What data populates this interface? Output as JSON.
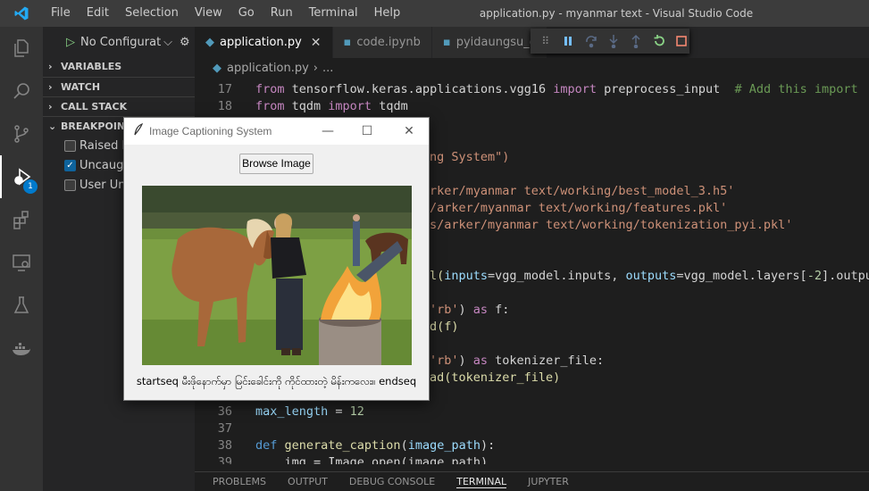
{
  "menubar": {
    "items": [
      "File",
      "Edit",
      "Selection",
      "View",
      "Go",
      "Run",
      "Terminal",
      "Help"
    ],
    "window_title": "application.py - myanmar text - Visual Studio Code"
  },
  "activitybar": {
    "icons": [
      "explorer-icon",
      "search-icon",
      "source-control-icon",
      "run-debug-icon",
      "extensions-icon",
      "remote-explorer-icon",
      "testing-icon",
      "docker-icon"
    ],
    "debug_badge": "1"
  },
  "sidebar": {
    "run_config": "No Configurat",
    "sections": {
      "variables": "VARIABLES",
      "watch": "WATCH",
      "call_stack": "CALL STACK",
      "breakpoints": "BREAKPOINTS"
    },
    "breakpoints": [
      {
        "label": "Raised Exceptions",
        "checked": false
      },
      {
        "label": "Uncaught Exceptions",
        "checked": true
      },
      {
        "label": "User Uncaught Exceptions",
        "checked": false
      }
    ]
  },
  "tabs": [
    {
      "label": "application.py",
      "active": true
    },
    {
      "label": "code.ipynb",
      "active": false
    },
    {
      "label": "pyidaungsu_c",
      "active": false
    }
  ],
  "breadcrumb": {
    "file": "application.py",
    "rest": "..."
  },
  "code": {
    "l17": {
      "num": "17",
      "t1": "from",
      "t2": " tensorflow.keras.applications.vgg16 ",
      "t3": "import",
      "t4": " preprocess_input  ",
      "t5": "# Add this import"
    },
    "l18": {
      "num": "18",
      "t1": "from",
      "t2": " tqdm ",
      "t3": "import",
      "t4": " tqdm"
    },
    "l_title": {
      "t1": "ng System\")"
    },
    "l_model": {
      "t1": "rker/myanmar text/working/best_model_3.h5'"
    },
    "l_feat": {
      "t1": "/arker/myanmar text/working/features.pkl'"
    },
    "l_tok": {
      "t1": "s/arker/myanmar text/working/tokenization_pyi.pkl'"
    },
    "l_vgg": {
      "t1": "l(",
      "t2": "inputs",
      "t3": "=vgg_model.inputs, ",
      "t4": "outputs",
      "t5": "=vgg_model.layers[",
      "t6": "-2",
      "t7": "].output)"
    },
    "l_rb1": {
      "t1": "'rb'",
      "t2": ") ",
      "t3": "as",
      "t4": " f:"
    },
    "l_load1": {
      "t1": "d(f)"
    },
    "l_rb2": {
      "t1": "'rb'",
      "t2": ") ",
      "t3": "as",
      "t4": " tokenizer_file:"
    },
    "l_load2": {
      "t1": "ad(tokenizer_file)"
    },
    "l36": {
      "num": "36",
      "t1": "max_length",
      "t2": " = ",
      "t3": "12"
    },
    "l37": {
      "num": "37"
    },
    "l38": {
      "num": "38",
      "t1": "def",
      "t2": " generate_caption",
      "t3": "(",
      "t4": "image_path",
      "t5": "):"
    },
    "l39": {
      "num": "39",
      "t1": "    img = Image.open(image_path)"
    }
  },
  "panel_tabs": [
    "PROBLEMS",
    "OUTPUT",
    "DEBUG CONSOLE",
    "TERMINAL",
    "JUPYTER"
  ],
  "dialog": {
    "title": "Image Captioning System",
    "browse_label": "Browse Image",
    "caption": "startseq မီးဖိုနောက်မှာ မြင်းခေါင်းကို ကိုင်ထားတဲ့ မိန်းကလေး။ endseq"
  },
  "colors": {
    "accent": "#007acc",
    "editor_bg": "#1e1e1e",
    "sidebar_bg": "#252526",
    "activitybar_bg": "#333333"
  }
}
